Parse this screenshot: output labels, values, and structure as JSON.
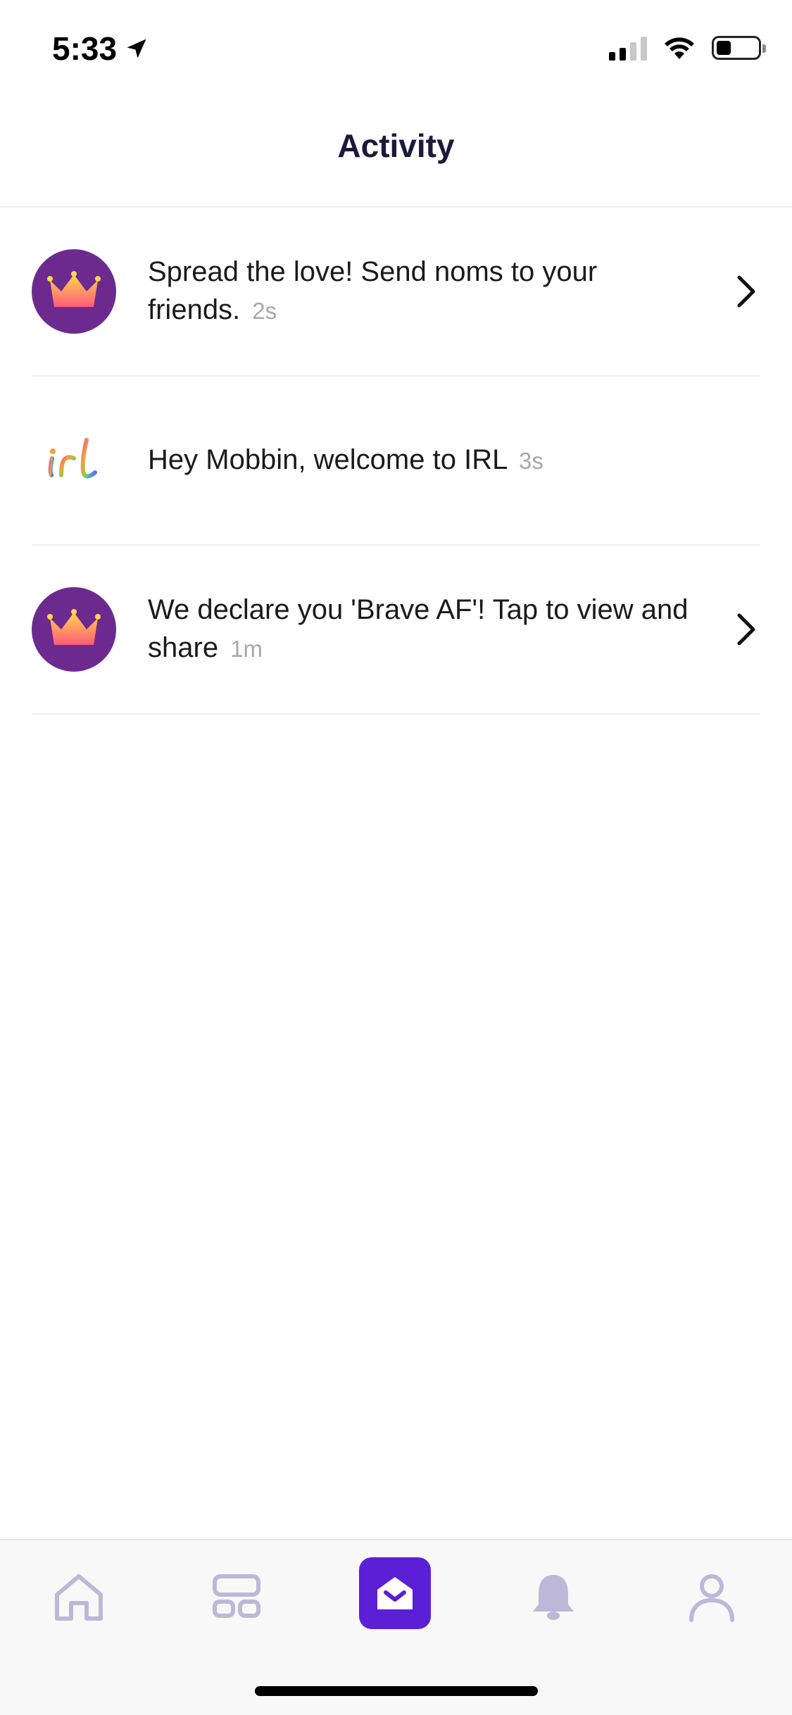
{
  "status_bar": {
    "time": "5:33",
    "location_icon": "location-arrow-icon",
    "signal_icon": "cellular-signal-icon",
    "wifi_icon": "wifi-icon",
    "battery_icon": "battery-icon"
  },
  "header": {
    "title": "Activity"
  },
  "activities": [
    {
      "icon": "crown-icon",
      "text": "Spread the love! Send noms to your friends.",
      "time": "2s",
      "has_chevron": true
    },
    {
      "icon": "irl-logo",
      "text": "Hey Mobbin, welcome to IRL",
      "time": "3s",
      "has_chevron": false
    },
    {
      "icon": "crown-icon",
      "text": "We declare you 'Brave AF'! Tap to view and share",
      "time": "1m",
      "has_chevron": true
    }
  ],
  "tab_bar": {
    "tabs": [
      {
        "name": "home",
        "icon": "home-icon",
        "active": false
      },
      {
        "name": "explore",
        "icon": "grid-icon",
        "active": false
      },
      {
        "name": "activity",
        "icon": "envelope-icon",
        "active": true
      },
      {
        "name": "notifications",
        "icon": "bell-icon",
        "active": false
      },
      {
        "name": "profile",
        "icon": "profile-icon",
        "active": false
      }
    ]
  },
  "colors": {
    "accent": "#5b1fd6",
    "avatar_bg": "#6c2a8f",
    "inactive_icon": "#bdb8d8",
    "muted_text": "#a8a8ae"
  }
}
